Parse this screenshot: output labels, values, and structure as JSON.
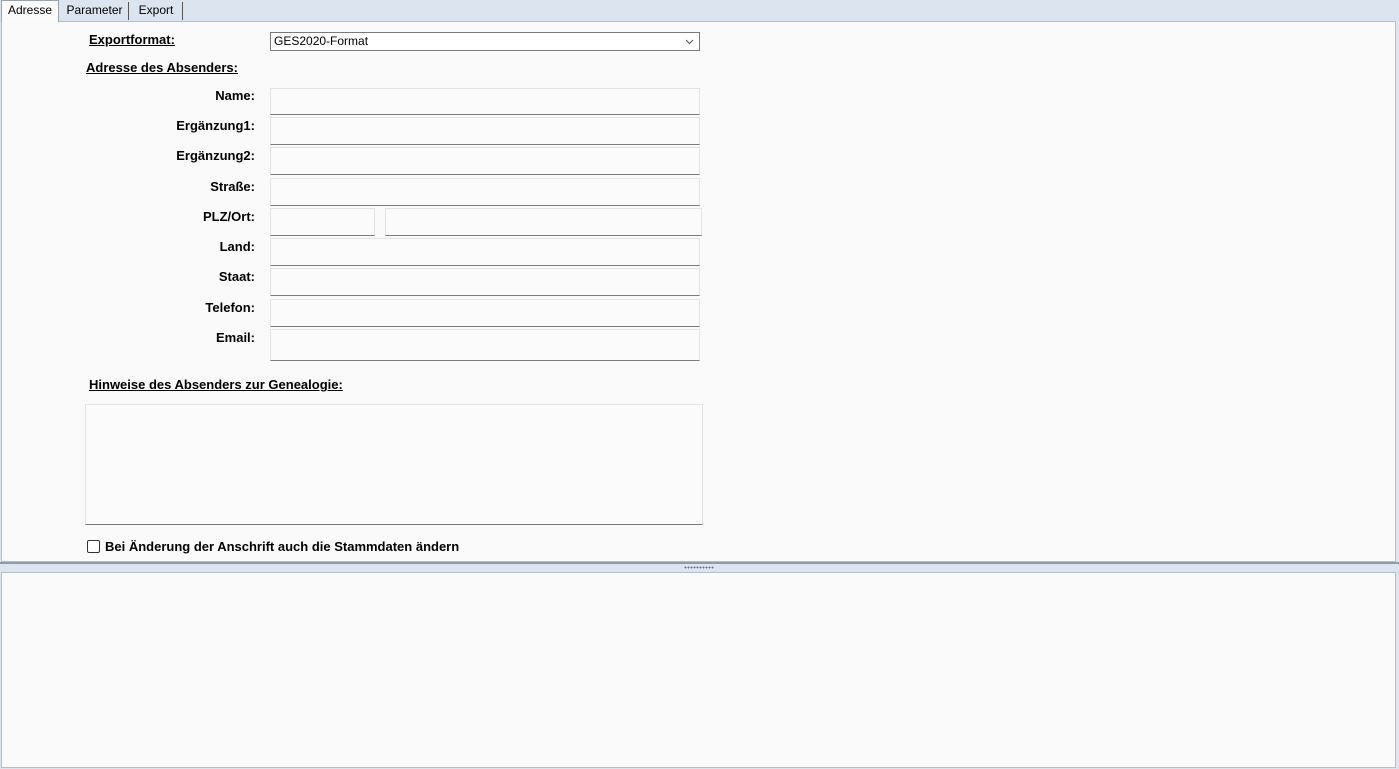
{
  "tabs": [
    {
      "label": "Adresse",
      "active": true
    },
    {
      "label": "Parameter",
      "active": false
    },
    {
      "label": "Export",
      "active": false
    }
  ],
  "form": {
    "exportformat_label": "Exportformat:",
    "exportformat_value": "GES2020-Format",
    "sender_section": "Adresse des Absenders:",
    "fields": {
      "name": {
        "label": "Name:",
        "value": ""
      },
      "ergaenzung1": {
        "label": "Ergänzung1:",
        "value": ""
      },
      "ergaenzung2": {
        "label": "Ergänzung2:",
        "value": ""
      },
      "strasse": {
        "label": "Straße:",
        "value": ""
      },
      "plz_ort": {
        "label": "PLZ/Ort:",
        "plz": "",
        "ort": ""
      },
      "land": {
        "label": "Land:",
        "value": ""
      },
      "staat": {
        "label": "Staat:",
        "value": ""
      },
      "telefon": {
        "label": "Telefon:",
        "value": ""
      },
      "email": {
        "label": "Email:",
        "value": ""
      }
    },
    "notes_section": "Hinweise des Absenders zur Genealogie:",
    "notes_value": "",
    "checkbox_label": "Bei Änderung der Anschrift auch die Stammdaten ändern",
    "checkbox_checked": false
  },
  "icons": {
    "select_arrow": "chevron-down-icon",
    "splitter_grip": "grip-dots-icon"
  },
  "colors": {
    "tabbar_bg": "#dce4ef",
    "panel_bg": "#fafafa",
    "splitter_line": "#8e9aa8"
  }
}
